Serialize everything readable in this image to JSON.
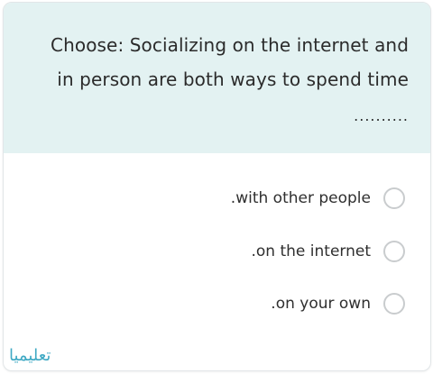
{
  "question": {
    "line1": "Choose: Socializing on the internet and",
    "line2": "in person are both ways to spend time",
    "blank": ".........."
  },
  "options": [
    {
      "label": ".with other people",
      "selected": false
    },
    {
      "label": ".on the internet",
      "selected": false
    },
    {
      "label": ".on your own",
      "selected": false
    }
  ],
  "watermark": "تعليميا",
  "colors": {
    "question_bg": "#e3f2f2",
    "radio_border": "#c9ccce",
    "watermark": "#3fa9c4"
  }
}
